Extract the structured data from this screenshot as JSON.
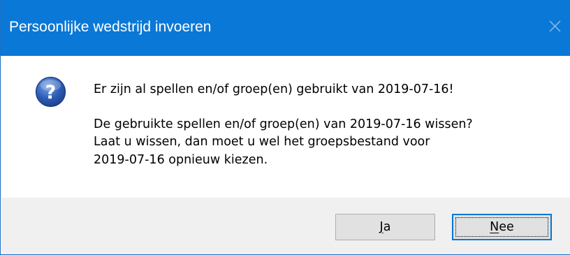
{
  "window": {
    "title": "Persoonlijke wedstrijd invoeren",
    "close_icon": "close-icon",
    "colors": {
      "titlebar": "#0a78d7",
      "footer": "#f0f0f0",
      "accent": "#0078d7"
    }
  },
  "dialog": {
    "icon": "question-icon",
    "lines": [
      "Er zijn al spellen en/of groep(en) gebruikt van 2019-07-16!",
      "De gebruikte spellen en/of groep(en) van 2019-07-16 wissen?",
      "Laat u wissen, dan moet u wel het groepsbestand voor",
      "2019-07-16 opnieuw kiezen."
    ]
  },
  "buttons": {
    "yes": {
      "label_first": "J",
      "label_rest": "a"
    },
    "no": {
      "label_first": "N",
      "label_rest": "ee"
    }
  }
}
